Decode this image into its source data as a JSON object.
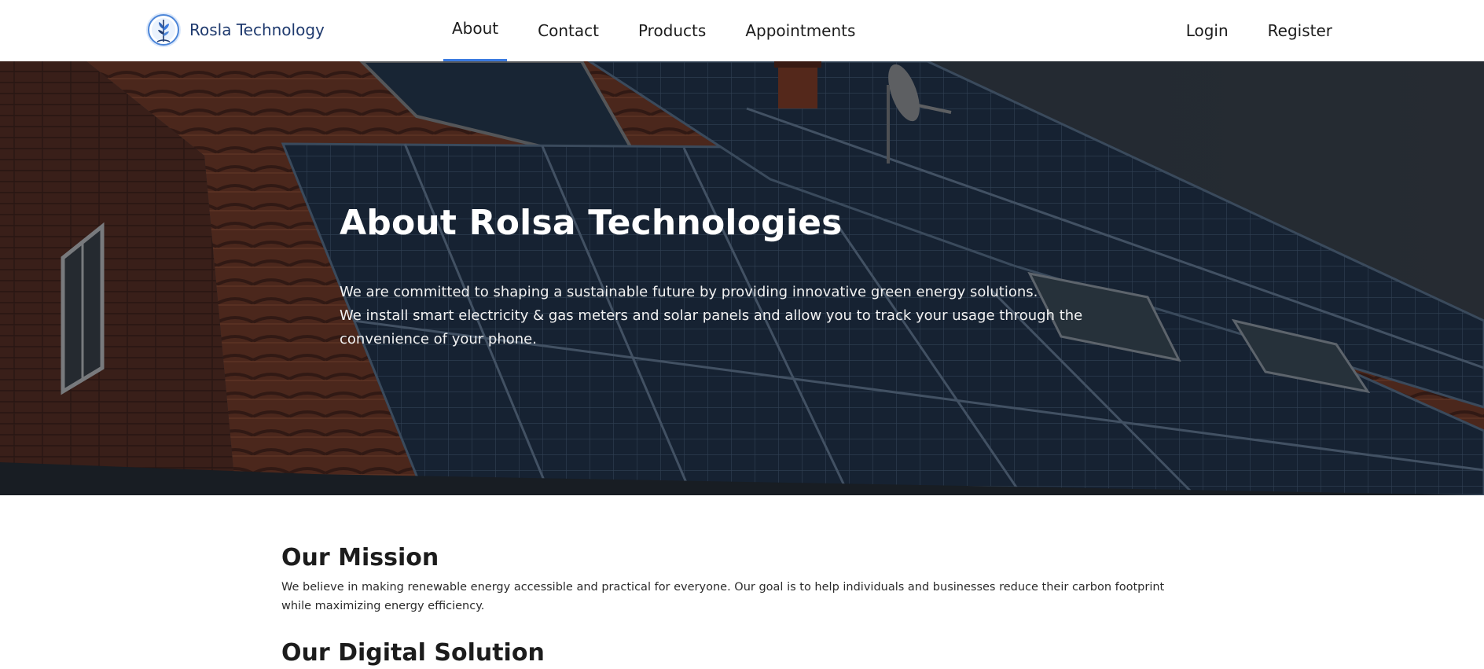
{
  "header": {
    "brand_name": "Rosla Technology",
    "logo_icon": "tree-globe-logo",
    "nav": [
      {
        "label": "About",
        "active": true
      },
      {
        "label": "Contact",
        "active": false
      },
      {
        "label": "Products",
        "active": false
      },
      {
        "label": "Appointments",
        "active": false
      }
    ],
    "auth": {
      "login": "Login",
      "register": "Register"
    },
    "accent_color": "#3b7be0"
  },
  "hero": {
    "title": "About Rolsa Technologies",
    "line1": "We are committed to shaping a sustainable future by providing innovative green energy solutions.",
    "line2": "We install smart electricity & gas meters and solar panels and allow you to track your usage through the convenience of your phone.",
    "background": "house-roof-solar-panels-photo"
  },
  "mission": {
    "title": "Our Mission",
    "text": "We believe in making renewable energy accessible and practical for everyone. Our goal is to help individuals and businesses reduce their carbon footprint while maximizing energy efficiency."
  },
  "digital": {
    "title": "Our Digital Solution"
  }
}
